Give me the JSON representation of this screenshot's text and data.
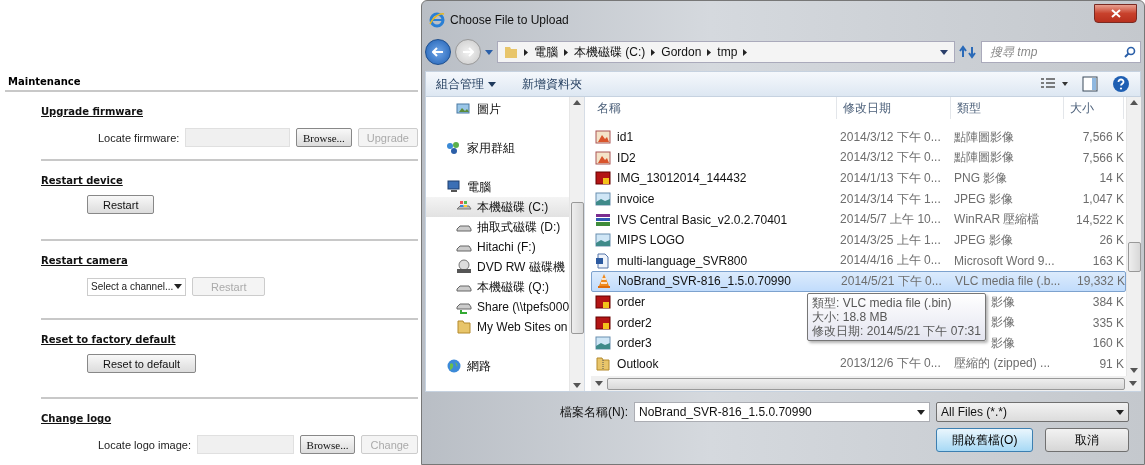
{
  "page": {
    "title": "Maintenance",
    "sections": [
      {
        "heading": "Upgrade firmware",
        "kind": "file",
        "label": "Locate firmware:",
        "browse": "Browse...",
        "action": {
          "label": "Upgrade",
          "disabled": true
        }
      },
      {
        "heading": "Restart device",
        "kind": "button",
        "action": {
          "label": "Restart",
          "disabled": false
        }
      },
      {
        "heading": "Restart camera",
        "kind": "select",
        "select": "Select a channel...",
        "action": {
          "label": "Restart",
          "disabled": true
        }
      },
      {
        "heading": "Reset to factory default",
        "kind": "button",
        "action": {
          "label": "Reset to default",
          "disabled": false
        }
      },
      {
        "heading": "Change logo",
        "kind": "file",
        "label": "Locate logo image:",
        "browse": "Browse...",
        "action": {
          "label": "Change",
          "disabled": true
        }
      }
    ]
  },
  "dialog": {
    "title": "Choose File to Upload",
    "breadcrumb": [
      "電腦",
      "本機磁碟 (C:)",
      "Gordon",
      "tmp"
    ],
    "search": {
      "placeholder": "搜尋 tmp"
    },
    "toolbar": [
      "組合管理",
      "新增資料夾"
    ],
    "nav": [
      {
        "label": "圖片",
        "kind": "pictures",
        "selected": false,
        "indent": true
      },
      {
        "label": "家用群組",
        "kind": "homegroup",
        "selected": false,
        "indent": false
      },
      {
        "label": "電腦",
        "kind": "computer",
        "selected": false,
        "indent": false
      },
      {
        "label": "本機磁碟 (C:)",
        "kind": "windrive",
        "selected": true,
        "indent": true
      },
      {
        "label": "抽取式磁碟 (D:)",
        "kind": "drive",
        "selected": false,
        "indent": true
      },
      {
        "label": "Hitachi (F:)",
        "kind": "drive",
        "selected": false,
        "indent": true
      },
      {
        "label": "DVD RW 磁碟機",
        "kind": "dvd",
        "selected": false,
        "indent": true
      },
      {
        "label": "本機磁碟 (Q:)",
        "kind": "drive",
        "selected": false,
        "indent": true
      },
      {
        "label": "Share (\\\\tpefs000",
        "kind": "netdrive",
        "selected": false,
        "indent": true
      },
      {
        "label": "My Web Sites on",
        "kind": "folder",
        "selected": false,
        "indent": true
      },
      {
        "label": "網路",
        "kind": "network",
        "selected": false,
        "indent": false
      }
    ],
    "columns": [
      "名稱",
      "修改日期",
      "類型",
      "大小"
    ],
    "files": [
      {
        "name": "id1",
        "kind": "bitmap",
        "date": "2014/3/12 下午 0...",
        "type": "點陣圖影像",
        "size": "7,566 K",
        "selected": false
      },
      {
        "name": "ID2",
        "kind": "bitmap",
        "date": "2014/3/12 下午 0...",
        "type": "點陣圖影像",
        "size": "7,566 K",
        "selected": false
      },
      {
        "name": "IMG_13012014_144432",
        "kind": "png",
        "date": "2014/1/13 下午 0...",
        "type": "PNG 影像",
        "size": "14 K",
        "selected": false
      },
      {
        "name": "invoice",
        "kind": "jpeg",
        "date": "2014/3/14 下午 1...",
        "type": "JPEG 影像",
        "size": "1,047 K",
        "selected": false
      },
      {
        "name": "IVS Central Basic_v2.0.2.70401",
        "kind": "archive",
        "date": "2014/5/7 上午 10...",
        "type": "WinRAR 壓縮檔",
        "size": "14,522 K",
        "selected": false
      },
      {
        "name": "MIPS LOGO",
        "kind": "jpeg",
        "date": "2014/3/25 上午 1...",
        "type": "JPEG 影像",
        "size": "26 K",
        "selected": false
      },
      {
        "name": "multi-language_SVR800",
        "kind": "word",
        "date": "2014/4/16 上午 0...",
        "type": "Microsoft Word 9...",
        "size": "163 K",
        "selected": false
      },
      {
        "name": "NoBrand_SVR-816_1.5.0.70990",
        "kind": "vlc",
        "date": "2014/5/21 下午 0...",
        "type": "VLC media file (.b...",
        "size": "19,332 K",
        "selected": true
      },
      {
        "name": "order",
        "kind": "png",
        "type": "影像",
        "size": "384 K",
        "selected": false
      },
      {
        "name": "order2",
        "kind": "png",
        "type": "影像",
        "size": "335 K",
        "selected": false
      },
      {
        "name": "order3",
        "kind": "jpeg",
        "type": "影像",
        "size": "160 K",
        "selected": false
      },
      {
        "name": "Outlook",
        "kind": "zip",
        "date": "2013/12/6 下午 0...",
        "type": "壓縮的 (zipped) ...",
        "size": "91 K",
        "selected": false
      }
    ],
    "tooltip": [
      "類型: VLC media file (.bin)",
      "大小: 18.8 MB",
      "修改日期: 2014/5/21 下午 07:31"
    ],
    "filename": {
      "label": "檔案名稱(N):",
      "value": "NoBrand_SVR-816_1.5.0.70990"
    },
    "filter": "All Files (*.*)",
    "buttons": [
      {
        "label": "開啟舊檔(O)",
        "kind": "primary"
      },
      {
        "label": "取消",
        "kind": "normal"
      }
    ]
  }
}
